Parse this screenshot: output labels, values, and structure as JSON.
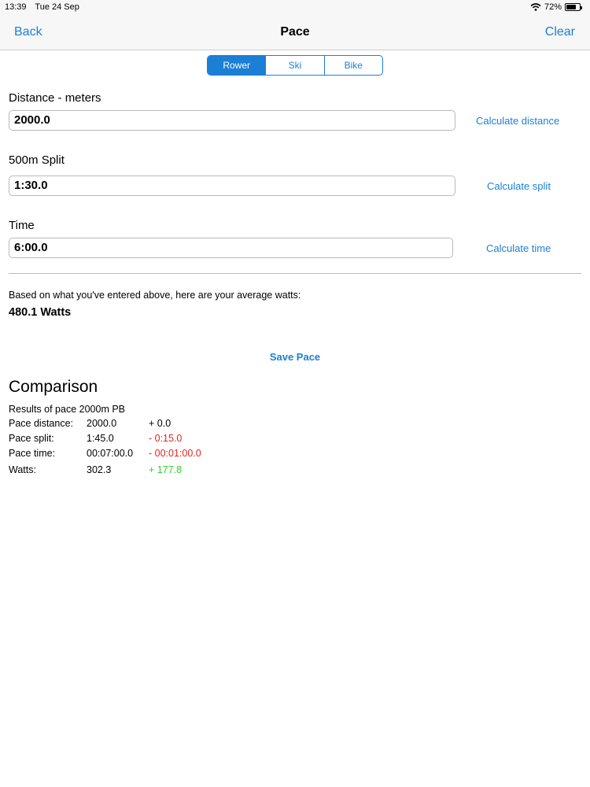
{
  "status": {
    "time": "13:39",
    "date": "Tue 24 Sep",
    "battery": "72%",
    "battery_level": 0.72,
    "wifi_icon": "wifi-icon",
    "battery_icon": "battery-icon"
  },
  "nav": {
    "back": "Back",
    "title": "Pace",
    "clear": "Clear"
  },
  "segments": [
    {
      "label": "Rower",
      "selected": true
    },
    {
      "label": "Ski",
      "selected": false
    },
    {
      "label": "Bike",
      "selected": false
    }
  ],
  "distance": {
    "label": "Distance - meters",
    "value": "2000.0",
    "action": "Calculate distance"
  },
  "split": {
    "label": "500m Split",
    "value": "1:30.0",
    "action": "Calculate split"
  },
  "time": {
    "label": "Time",
    "value": "6:00.0",
    "action": "Calculate time"
  },
  "watts": {
    "description": "Based on what you've entered above, here are your average watts:",
    "value": "480.1 Watts"
  },
  "save_label": "Save Pace",
  "comparison": {
    "title": "Comparison",
    "header": "Results of pace 2000m PB",
    "rows": [
      {
        "label": "Pace distance:",
        "value": "2000.0",
        "diff": "+ 0.0",
        "diff_color": "#000000"
      },
      {
        "label": "Pace split:",
        "value": "1:45.0",
        "diff": "- 0:15.0",
        "diff_color": "#e0261b"
      },
      {
        "label": "Pace time:",
        "value": "00:07:00.0",
        "diff": "- 00:01:00.0",
        "diff_color": "#e0261b"
      },
      {
        "label": "Watts:",
        "value": "302.3",
        "diff": "+ 177.8",
        "diff_color": "#2fd12f"
      }
    ]
  },
  "colors": {
    "accent": "#1b7fd6",
    "negative": "#e0261b",
    "positive": "#2fd12f"
  }
}
